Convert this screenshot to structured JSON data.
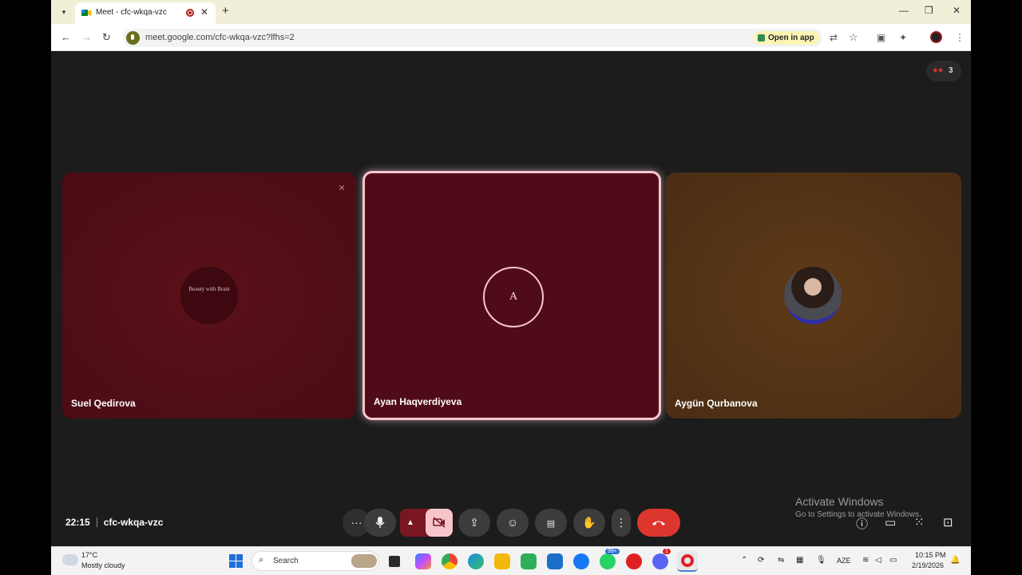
{
  "browser": {
    "tab_title": "Meet - cfc-wkqa-vzc",
    "url": "meet.google.com/cfc-wkqa-vzc?lfhs=2",
    "open_in_app_label": "Open in app",
    "new_tab_label": "+",
    "close_tab_label": "✕",
    "window_controls": {
      "minimize": "—",
      "restore": "❐",
      "close": "✕"
    }
  },
  "meeting": {
    "participant_count": "3",
    "time": "22:15",
    "code": "cfc-wkqa-vzc",
    "tiles": [
      {
        "name": "Suel Qedirova",
        "avatar_text": "Beauty with Brain",
        "muted": true
      },
      {
        "name": "Ayan Haqverdiyeva",
        "avatar_initial": "A",
        "active_speaker": true
      },
      {
        "name": "Aygün Qurbanova",
        "avatar": "photo"
      }
    ],
    "controls": [
      "more-options",
      "microphone",
      "camera-options",
      "camera-off",
      "present",
      "reactions",
      "captions",
      "raise-hand",
      "more",
      "leave-call"
    ]
  },
  "watermark": {
    "title": "Activate Windows",
    "subtitle": "Go to Settings to activate Windows."
  },
  "taskbar": {
    "weather_temp": "17°C",
    "weather_desc": "Mostly cloudy",
    "search_label": "Search",
    "whatsapp_badge": "99+",
    "discord_badge": "1",
    "language": "AZE",
    "clock_time": "10:15 PM",
    "clock_date": "2/19/2026"
  },
  "colors": {
    "meet_background": "#1c1c1c",
    "active_border": "#f7c6cf",
    "end_call": "#dc362e",
    "camera_off": "#f6c6cc"
  }
}
